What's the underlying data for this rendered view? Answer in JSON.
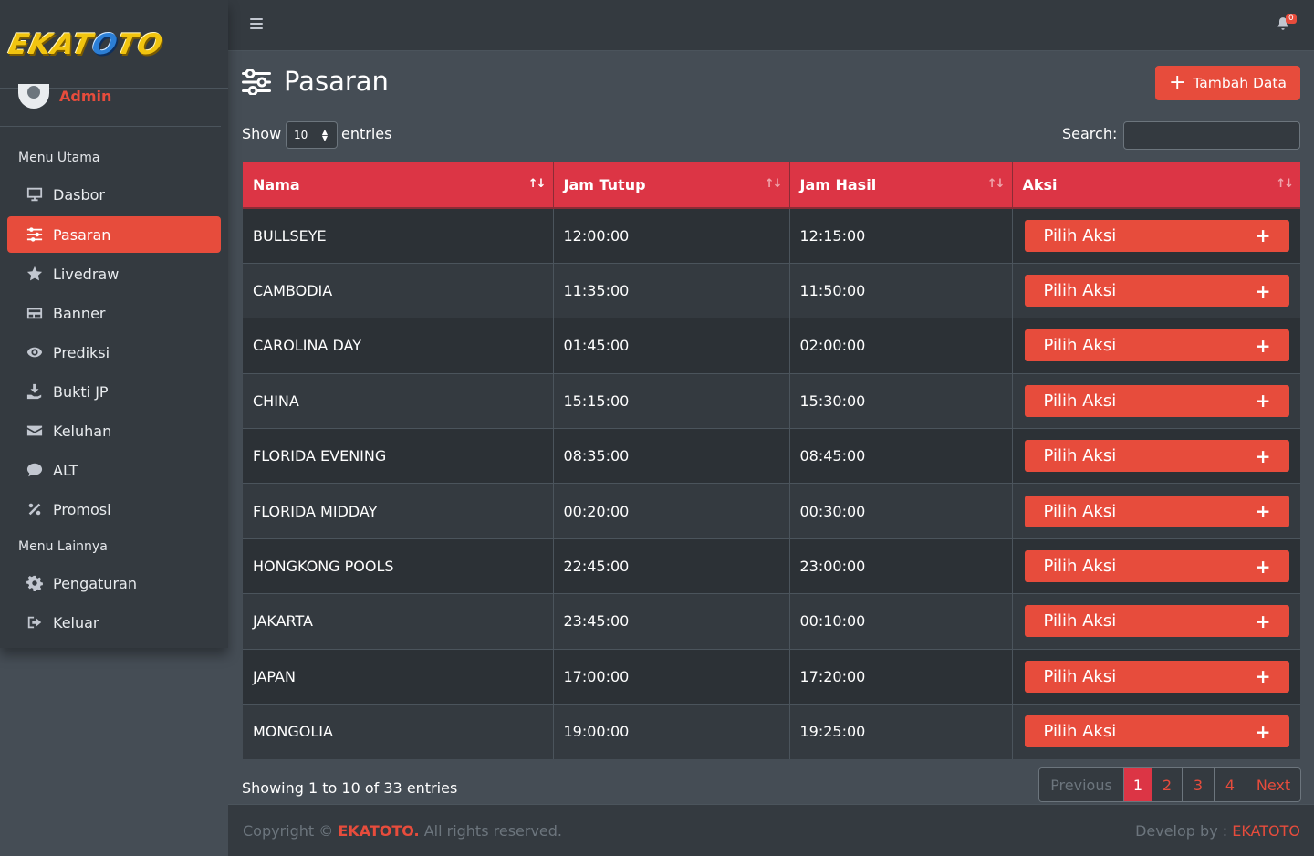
{
  "brand": {
    "logo_part1": "EKAT",
    "logo_part2": "O",
    "logo_part3": "TO",
    "user": "Admin"
  },
  "sidebar": {
    "header_main": "Menu Utama",
    "header_other": "Menu Lainnya",
    "items": [
      {
        "label": "Dasbor",
        "icon": "desktop-icon"
      },
      {
        "label": "Pasaran",
        "icon": "sliders-icon"
      },
      {
        "label": "Livedraw",
        "icon": "star-icon"
      },
      {
        "label": "Banner",
        "icon": "banner-icon"
      },
      {
        "label": "Prediksi",
        "icon": "eye-icon"
      },
      {
        "label": "Bukti JP",
        "icon": "hand-holding-icon"
      },
      {
        "label": "Keluhan",
        "icon": "envelope-icon"
      },
      {
        "label": "ALT",
        "icon": "comment-icon"
      },
      {
        "label": "Promosi",
        "icon": "percent-icon"
      },
      {
        "label": "Pengaturan",
        "icon": "gear-icon"
      },
      {
        "label": "Keluar",
        "icon": "logout-icon"
      }
    ]
  },
  "topbar": {
    "notification_count": "0"
  },
  "page": {
    "title": "Pasaran",
    "add_button": "Tambah Data"
  },
  "table_controls": {
    "show": "Show",
    "length": "10",
    "entries": "entries",
    "search_label": "Search:",
    "search_value": ""
  },
  "table": {
    "headers": [
      "Nama",
      "Jam Tutup",
      "Jam Hasil",
      "Aksi"
    ],
    "action_label": "Pilih Aksi",
    "rows": [
      [
        "BULLSEYE",
        "12:00:00",
        "12:15:00"
      ],
      [
        "CAMBODIA",
        "11:35:00",
        "11:50:00"
      ],
      [
        "CAROLINA DAY",
        "01:45:00",
        "02:00:00"
      ],
      [
        "CHINA",
        "15:15:00",
        "15:30:00"
      ],
      [
        "FLORIDA EVENING",
        "08:35:00",
        "08:45:00"
      ],
      [
        "FLORIDA MIDDAY",
        "00:20:00",
        "00:30:00"
      ],
      [
        "HONGKONG POOLS",
        "22:45:00",
        "23:00:00"
      ],
      [
        "JAKARTA",
        "23:45:00",
        "00:10:00"
      ],
      [
        "JAPAN",
        "17:00:00",
        "17:20:00"
      ],
      [
        "MONGOLIA",
        "19:00:00",
        "19:25:00"
      ]
    ]
  },
  "footer_info": {
    "showing": "Showing 1 to 10 of 33 entries"
  },
  "pagination": {
    "previous": "Previous",
    "pages": [
      "1",
      "2",
      "3",
      "4"
    ],
    "next": "Next",
    "active": "1"
  },
  "footer": {
    "copyright_prefix": "Copyright ©",
    "brand": "EKATOTO.",
    "copyright_suffix": "All rights reserved.",
    "develop_prefix": "Develop by :",
    "develop_brand": "EKATOTO"
  },
  "colors": {
    "accent": "#e74c3c",
    "table_header": "#dc3545",
    "sidebar_bg": "#343a40",
    "content_bg": "#454d55"
  }
}
